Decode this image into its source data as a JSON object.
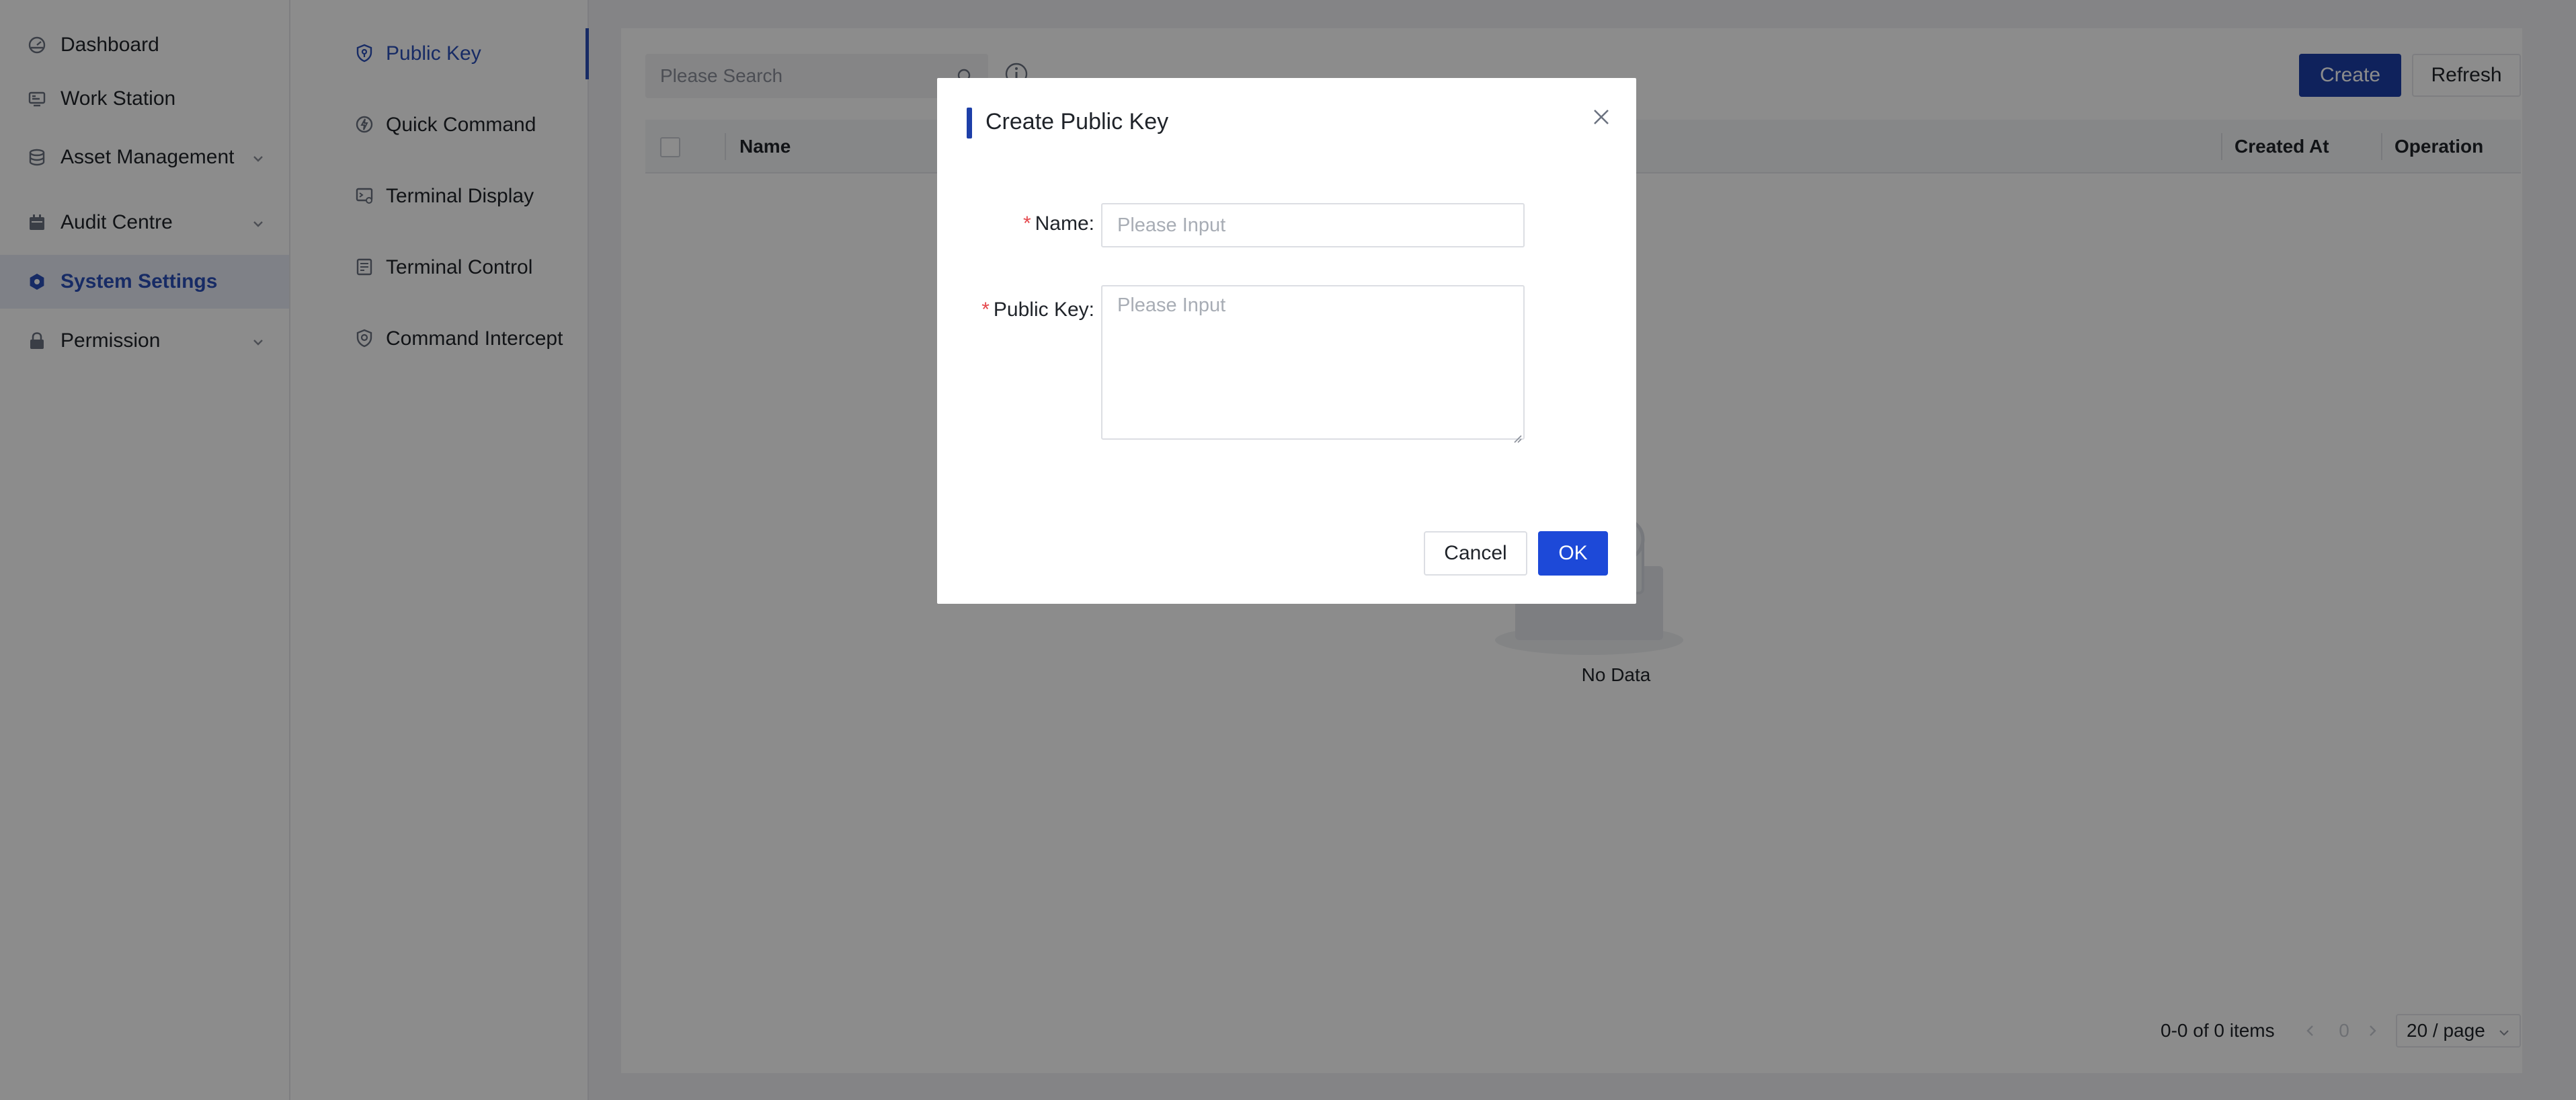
{
  "sidebar": {
    "items": [
      {
        "label": "Dashboard",
        "icon": "dashboard-icon"
      },
      {
        "label": "Work Station",
        "icon": "workstation-icon"
      },
      {
        "label": "Asset Management",
        "icon": "database-icon",
        "expandable": true
      },
      {
        "label": "Audit Centre",
        "icon": "calendar-icon",
        "expandable": true
      },
      {
        "label": "System Settings",
        "icon": "settings-icon",
        "active": true
      },
      {
        "label": "Permission",
        "icon": "lock-icon",
        "expandable": true
      }
    ]
  },
  "settings_nav": {
    "items": [
      {
        "label": "Public Key",
        "icon": "shield-key-icon",
        "active": true
      },
      {
        "label": "Quick Command",
        "icon": "quick-command-icon"
      },
      {
        "label": "Terminal Display",
        "icon": "terminal-display-icon"
      },
      {
        "label": "Terminal Control",
        "icon": "terminal-control-icon"
      },
      {
        "label": "Command Intercept",
        "icon": "shield-icon"
      }
    ]
  },
  "toolbar": {
    "search_placeholder": "Please Search",
    "create_label": "Create",
    "refresh_label": "Refresh"
  },
  "table": {
    "columns": [
      "Name",
      "Created At",
      "Operation"
    ],
    "empty_text": "No Data"
  },
  "pagination": {
    "total": "0-0 of 0 items",
    "current_page": "0",
    "page_size": "20 / page"
  },
  "modal": {
    "title": "Create Public Key",
    "fields": [
      {
        "label": "Name",
        "placeholder": "Please Input",
        "required": true
      },
      {
        "label": "Public Key",
        "placeholder": "Please Input",
        "required": true
      }
    ],
    "cancel_label": "Cancel",
    "ok_label": "OK"
  },
  "colors": {
    "accent": "#2a4fb8",
    "primary_button": "#1d3fa8",
    "ok_button": "#1d49d8",
    "required": "#e5484d"
  }
}
